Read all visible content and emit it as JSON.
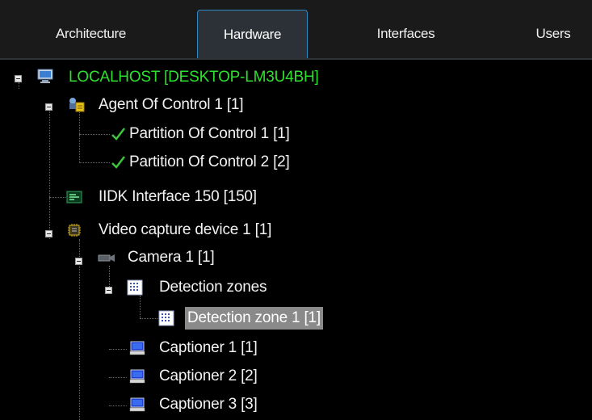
{
  "tabs": [
    {
      "label": "Architecture",
      "active": false
    },
    {
      "label": "Hardware",
      "active": true
    },
    {
      "label": "Interfaces",
      "active": false
    },
    {
      "label": "Users",
      "active": false
    }
  ],
  "tree": {
    "localhost": "LOCALHOST [DESKTOP-LM3U4BH]",
    "agent": "Agent Of Control 1 [1]",
    "partition1": "Partition Of Control 1 [1]",
    "partition2": "Partition Of Control 2 [2]",
    "iidk": "IIDK Interface 150 [150]",
    "video": "Video capture device 1 [1]",
    "camera": "Camera 1 [1]",
    "zones": "Detection zones",
    "zone1": "Detection zone 1 [1]",
    "captioner1": "Captioner 1 [1]",
    "captioner2": "Captioner 2 [2]",
    "captioner3": "Captioner 3 [3]"
  },
  "colors": {
    "active_tab_border": "#2e8bc4",
    "host_label": "#2ee02e",
    "selection": "#8a8a8a",
    "background": "#000000"
  },
  "icons": {
    "localhost": "monitor-icon",
    "agent": "agent-icon",
    "partition": "checkmark-icon",
    "iidk": "interface-icon",
    "video": "chip-icon",
    "camera": "camera-icon",
    "zones": "grid-icon",
    "captioner": "computer-icon"
  }
}
